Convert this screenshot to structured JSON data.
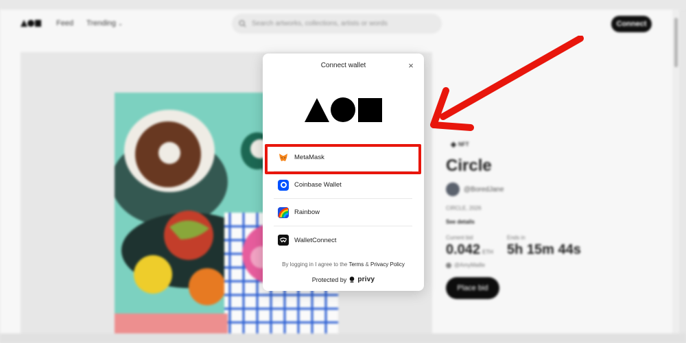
{
  "nav": {
    "items": [
      {
        "label": "Feed"
      },
      {
        "label": "Trending"
      }
    ],
    "search_placeholder": "Search artworks, collections, artists or words",
    "connect_label": "Connect"
  },
  "artwork": {
    "badge": "NFT",
    "title": "Circle",
    "creator": "@BoredJane",
    "edition": "CIRCLE, 2026",
    "see_details": "See details",
    "current_bid_label": "Current bid",
    "current_bid_value": "0.042",
    "current_bid_unit": "ETH",
    "bidder": "@AmyMaille",
    "ends_in_label": "Ends in",
    "ends_in_value": "5h 15m 44s",
    "place_bid_label": "Place bid"
  },
  "modal": {
    "title": "Connect wallet",
    "close_symbol": "×",
    "wallets": [
      {
        "label": "MetaMask",
        "icon": "metamask-fox-icon",
        "color": "#f6851b"
      },
      {
        "label": "Coinbase Wallet",
        "icon": "coinbase-icon",
        "color": "#0052ff"
      },
      {
        "label": "Rainbow",
        "icon": "rainbow-icon",
        "color": "#1c4de0"
      },
      {
        "label": "WalletConnect",
        "icon": "walletconnect-icon",
        "color": "#111111"
      }
    ],
    "terms_prefix": "By logging in I agree to the",
    "terms_link": "Terms",
    "terms_and": "&",
    "privacy_link": "Privacy Policy",
    "protected_by": "Protected by",
    "privy": "privy"
  },
  "annotation": {
    "highlight_color": "#e8160c"
  }
}
